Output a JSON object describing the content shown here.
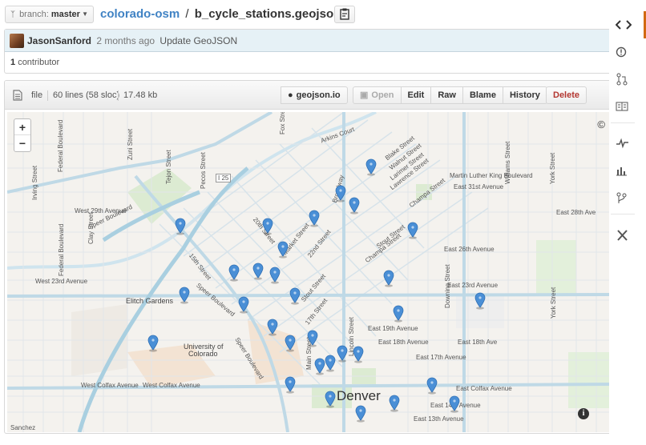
{
  "branch": {
    "label": "branch:",
    "name": "master"
  },
  "breadcrumb": {
    "repo": "colorado-osm",
    "separator": "/",
    "file": "b_cycle_stations.geojson"
  },
  "commit": {
    "author": "JasonSanford",
    "time_ago": "2 months ago",
    "message": "Update GeoJSON"
  },
  "contributors": {
    "count": "1",
    "label": "contributor"
  },
  "file_header": {
    "type": "file",
    "lines": "60 lines (58 sloc)",
    "size": "17.48 kb"
  },
  "buttons": {
    "geojson_io": "geojson.io",
    "open": "Open",
    "edit": "Edit",
    "raw": "Raw",
    "blame": "Blame",
    "history": "History",
    "delete": "Delete"
  },
  "map": {
    "zoom_in": "+",
    "zoom_out": "−",
    "copyright_symbol": "©",
    "info_symbol": "i",
    "labels": {
      "denver": "Denver",
      "elitch": "Elitch Gardens",
      "university_1": "University of",
      "university_2": "Colorado",
      "w29": "West 29th Avenue",
      "w23": "West 23rd Avenue",
      "wcolfax1": "West Colfax Avenue",
      "wcolfax2": "West Colfax Avenue",
      "mlk": "Martin Luther King Boulevard",
      "e31": "East 31st Avenue",
      "e26": "East 26th Avenue",
      "e23": "East 23rd Avenue",
      "e19": "East 19th Avenue",
      "e18": "East 18th Avenue",
      "e17": "East 17th Avenue",
      "e14": "East 14th Avenue",
      "e13": "East 13th Avenue",
      "ecolfax": "East Colfax Avenue",
      "e28": "East 28th Ave",
      "e18b": "East 18th Ave",
      "arkins": "Arkins Court",
      "blake": "Blake Street",
      "walnut": "Walnut Street",
      "larimer": "Larimer Street",
      "lawrence": "Lawrence Street",
      "champa1": "Champa Street",
      "champa2": "Champa Street",
      "stout1": "Stout Street",
      "stout2": "Stout Street",
      "downing": "Downing Street",
      "williams": "Williams Street",
      "york": "York Street",
      "pecos": "Pecos Street",
      "tejon": "Tejon Street",
      "zuni": "Zuni Street",
      "federal": "Federal Boulevard",
      "federal2": "Federal Boulevard",
      "irving": "Irving Street",
      "clay": "Clay Street",
      "speer": "Speer Boulevard",
      "speer2": "Speer Boulevard",
      "speer3": "Speer Boulevard",
      "st15": "15th Street",
      "st17": "17th Street",
      "st22": "22nd Street",
      "st20": "20th Street",
      "market": "Market Street",
      "fox": "Fox Street",
      "broadway": "Broadway",
      "lincoln": "Lincoln Street",
      "sanchez": "Sanchez",
      "i25": "I 25",
      "mainst": "Main Street",
      "larimer2": "Larimer Street",
      "e17b": "East 17th Ave",
      "york2": "York Street"
    },
    "marker_count": 32
  },
  "colors": {
    "accent": "#d26911",
    "link": "#4183c4",
    "marker": "#4a8fd6",
    "delete": "#b33630"
  },
  "rail_icons": [
    "code-icon",
    "issue-icon",
    "pull-request-icon",
    "wiki-icon",
    "pulse-icon",
    "graph-icon",
    "network-icon",
    "settings-icon"
  ]
}
